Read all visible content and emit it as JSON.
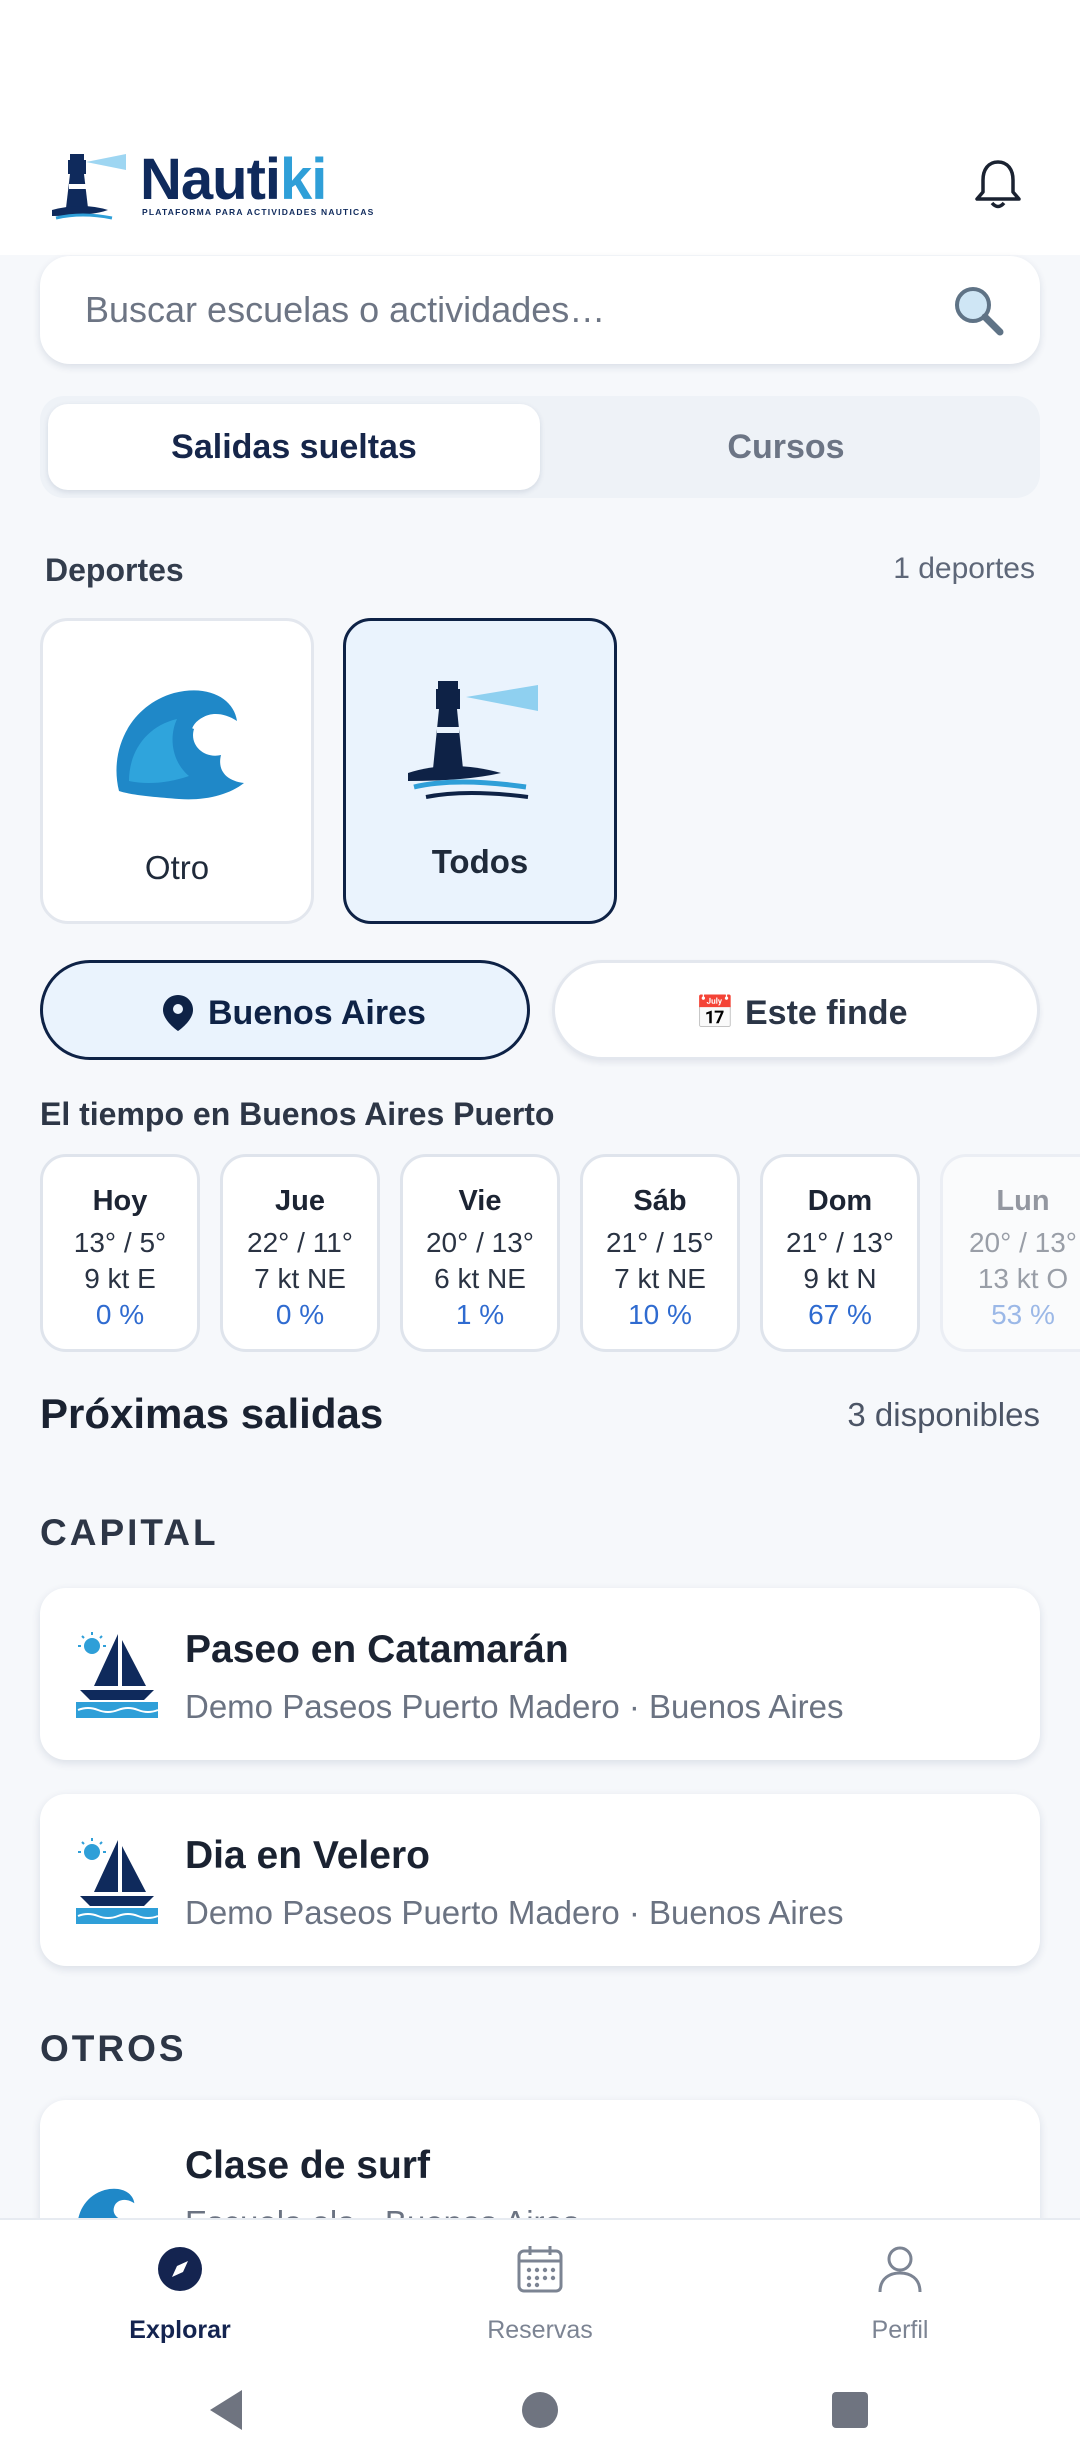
{
  "brand": {
    "name_a": "Nauti",
    "name_b": "ki",
    "tagline": "PLATAFORMA PARA ACTIVIDADES NAUTICAS"
  },
  "search": {
    "placeholder": "Buscar escuelas o actividades…",
    "icon": "search-icon"
  },
  "tabs": [
    {
      "label": "Salidas sueltas",
      "selected": true
    },
    {
      "label": "Cursos",
      "selected": false
    }
  ],
  "sports": {
    "label": "Deportes",
    "count": "1 deportes",
    "items": [
      {
        "label": "Otro",
        "icon": "wave-icon"
      },
      {
        "label": "Todos",
        "icon": "lighthouse-icon",
        "selected": true
      }
    ]
  },
  "filters": {
    "location": "Buenos Aires",
    "date": "Este finde",
    "date_icon": "📅"
  },
  "weather": {
    "title": "El tiempo en Buenos Aires Puerto",
    "days": [
      {
        "day": "Hoy",
        "temp": "13° / 5°",
        "wind": "9 kt E",
        "rain": "0 %"
      },
      {
        "day": "Jue",
        "temp": "22° / 11°",
        "wind": "7 kt NE",
        "rain": "0 %"
      },
      {
        "day": "Vie",
        "temp": "20° / 13°",
        "wind": "6 kt NE",
        "rain": "1 %"
      },
      {
        "day": "Sáb",
        "temp": "21° / 15°",
        "wind": "7 kt NE",
        "rain": "10 %"
      },
      {
        "day": "Dom",
        "temp": "21° / 13°",
        "wind": "9 kt N",
        "rain": "67 %"
      },
      {
        "day": "Lun",
        "temp": "20° / 13°",
        "wind": "13 kt O",
        "rain": "53 %"
      }
    ]
  },
  "upcoming": {
    "title": "Próximas salidas",
    "count": "3 disponibles",
    "groups": [
      {
        "name": "CAPITAL",
        "items": [
          {
            "title": "Paseo en Catamarán",
            "subtitle": "Demo Paseos Puerto Madero · Buenos Aires",
            "icon": "sailboat-icon"
          },
          {
            "title": "Dia en Velero",
            "subtitle": "Demo Paseos Puerto Madero · Buenos Aires",
            "icon": "sailboat-icon"
          }
        ]
      },
      {
        "name": "OTROS",
        "items": [
          {
            "title": "Clase de surf",
            "subtitle": "Escuela ola · Buenos Aires",
            "icon": "wave-icon"
          }
        ]
      }
    ]
  },
  "nav": [
    {
      "label": "Explorar",
      "icon": "compass-icon",
      "selected": true
    },
    {
      "label": "Reservas",
      "icon": "calendar-icon"
    },
    {
      "label": "Perfil",
      "icon": "user-icon"
    }
  ],
  "colors": {
    "primary": "#0e2246",
    "accent": "#2f9fd8",
    "background": "#f6f8fb",
    "rain": "#2f6bd0"
  }
}
